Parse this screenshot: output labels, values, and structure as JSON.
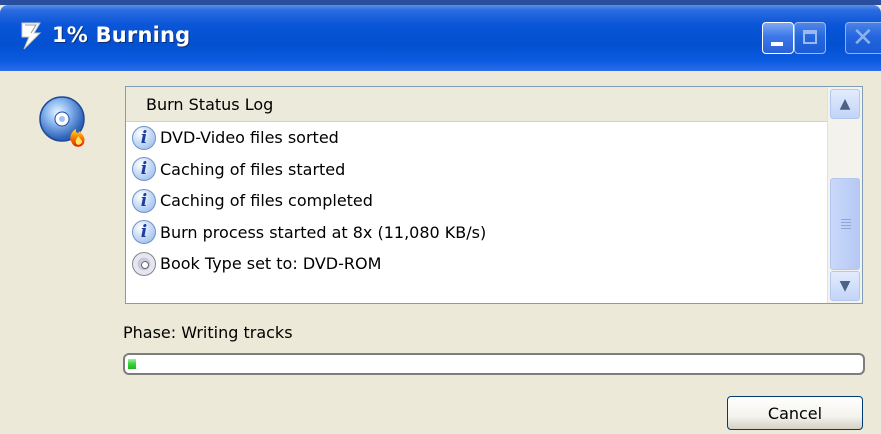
{
  "window": {
    "title": "1% Burning",
    "icon": "burn-disc-icon"
  },
  "title_buttons": {
    "minimize": "minimize-icon",
    "maximize": "maximize-icon",
    "close": "close-icon"
  },
  "log": {
    "header": "Burn Status Log",
    "entries": [
      {
        "icon": "info-icon",
        "text": "DVD-Video files sorted"
      },
      {
        "icon": "info-icon",
        "text": "Caching of files started"
      },
      {
        "icon": "info-icon",
        "text": "Caching of files completed"
      },
      {
        "icon": "info-icon",
        "text": "Burn process started at 8x (11,080 KB/s)"
      },
      {
        "icon": "disc-icon",
        "text": "Book Type set to: DVD-ROM"
      }
    ]
  },
  "phase": {
    "text": "Phase: Writing tracks"
  },
  "progress": {
    "fraction": 0.01,
    "color": "#3ad23a"
  },
  "buttons": {
    "cancel": "Cancel"
  },
  "colors": {
    "titlebar": "#0350d0",
    "window_bg": "#ece9d8"
  }
}
